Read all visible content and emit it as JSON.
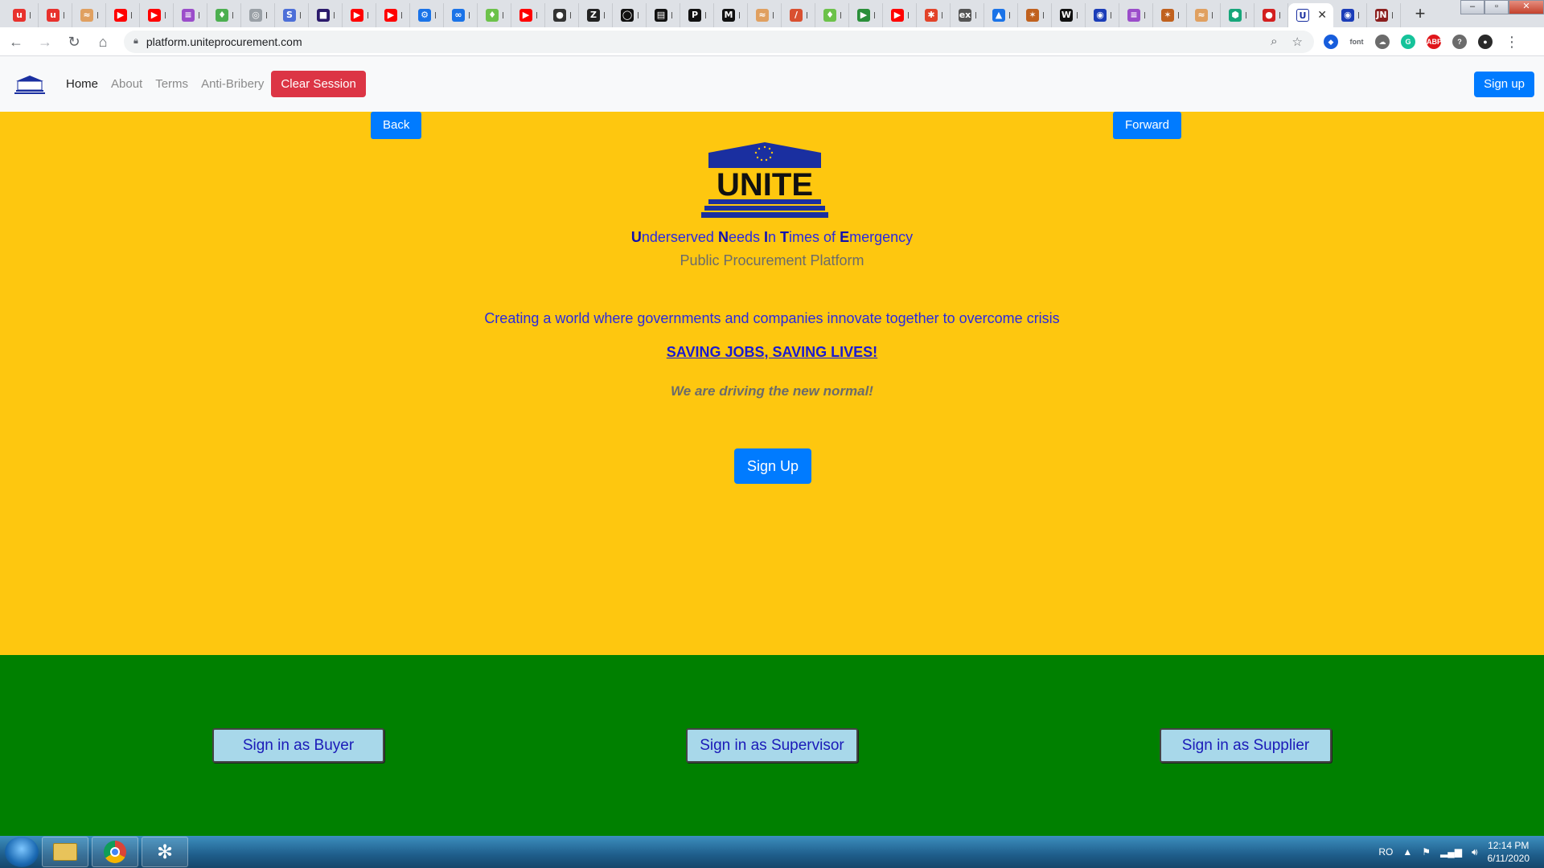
{
  "browser": {
    "tabs": [
      {
        "icon": "hermes-icon",
        "color": "#e8312d",
        "glyph": "u"
      },
      {
        "icon": "hermes-icon",
        "color": "#e8312d",
        "glyph": "u"
      },
      {
        "icon": "app-icon",
        "color": "#e0a060",
        "glyph": "≈"
      },
      {
        "icon": "youtube-icon",
        "color": "#ff0000",
        "glyph": "▶"
      },
      {
        "icon": "youtube-icon",
        "color": "#ff0000",
        "glyph": "▶"
      },
      {
        "icon": "app-icon",
        "color": "#9b4dca",
        "glyph": "≡"
      },
      {
        "icon": "leaf-icon",
        "color": "#4caf50",
        "glyph": "♦"
      },
      {
        "icon": "globe-icon",
        "color": "#9aa0a6",
        "glyph": "◎"
      },
      {
        "icon": "s-icon",
        "color": "#4d6fd8",
        "glyph": "S"
      },
      {
        "icon": "dark-icon",
        "color": "#2b1a6b",
        "glyph": "■"
      },
      {
        "icon": "youtube-icon",
        "color": "#ff0000",
        "glyph": "▶"
      },
      {
        "icon": "youtube-icon",
        "color": "#ff0000",
        "glyph": "▶"
      },
      {
        "icon": "gear-icon",
        "color": "#1a73e8",
        "glyph": "⚙"
      },
      {
        "icon": "link-icon",
        "color": "#1a73e8",
        "glyph": "∞"
      },
      {
        "icon": "leaf-icon",
        "color": "#6cc24a",
        "glyph": "♦"
      },
      {
        "icon": "youtube-icon",
        "color": "#ff0000",
        "glyph": "▶"
      },
      {
        "icon": "github-icon",
        "color": "#333333",
        "glyph": "●"
      },
      {
        "icon": "z-icon",
        "color": "#222222",
        "glyph": "Z"
      },
      {
        "icon": "circle-icon",
        "color": "#111111",
        "glyph": "◯"
      },
      {
        "icon": "terminal-icon",
        "color": "#111111",
        "glyph": "▤"
      },
      {
        "icon": "p-icon",
        "color": "#111111",
        "glyph": "P"
      },
      {
        "icon": "medium-icon",
        "color": "#111111",
        "glyph": "M"
      },
      {
        "icon": "app-icon",
        "color": "#e0a060",
        "glyph": "≈"
      },
      {
        "icon": "slash-icon",
        "color": "#d95030",
        "glyph": "/"
      },
      {
        "icon": "leaf-icon",
        "color": "#6cc24a",
        "glyph": "♦"
      },
      {
        "icon": "play-icon",
        "color": "#2a8f3a",
        "glyph": "▶"
      },
      {
        "icon": "youtube-icon",
        "color": "#ff0000",
        "glyph": "▶"
      },
      {
        "icon": "gitlab-icon",
        "color": "#e24329",
        "glyph": "✱"
      },
      {
        "icon": "ex-icon",
        "color": "#555555",
        "glyph": "ex"
      },
      {
        "icon": "cap-icon",
        "color": "#1a73e8",
        "glyph": "▲"
      },
      {
        "icon": "star-icon",
        "color": "#c0611e",
        "glyph": "✶"
      },
      {
        "icon": "wikipedia-icon",
        "color": "#111111",
        "glyph": "W"
      },
      {
        "icon": "eu-icon",
        "color": "#1b3db8",
        "glyph": "◉"
      },
      {
        "icon": "app-icon",
        "color": "#9b4dca",
        "glyph": "≡"
      },
      {
        "icon": "star-icon",
        "color": "#c0611e",
        "glyph": "✶"
      },
      {
        "icon": "app-icon",
        "color": "#e0a060",
        "glyph": "≈"
      },
      {
        "icon": "shield-icon",
        "color": "#17a67a",
        "glyph": "⬢"
      },
      {
        "icon": "record-icon",
        "color": "#d31f1f",
        "glyph": "●"
      }
    ],
    "active_tab": {
      "icon": "unite-tab-icon",
      "glyph": "U"
    },
    "trailing_tabs": [
      {
        "icon": "eu-icon",
        "color": "#1b3db8",
        "glyph": "◉"
      },
      {
        "icon": "jn-icon",
        "color": "#8b1f1f",
        "glyph": "JN"
      }
    ],
    "url": "platform.uniteprocurement.com",
    "extensions": [
      {
        "icon": "bitwarden-icon",
        "color": "#175ddc",
        "glyph": "◆"
      },
      {
        "icon": "font-icon",
        "color": "#5f6368",
        "glyph": "font"
      },
      {
        "icon": "cloud-icon",
        "color": "#6b6b6b",
        "glyph": "☁"
      },
      {
        "icon": "grammarly-icon",
        "color": "#15c39a",
        "glyph": "G"
      },
      {
        "icon": "adblock-icon",
        "color": "#e0161b",
        "glyph": "ABP"
      },
      {
        "icon": "extension-badge-icon",
        "color": "#6b6b6b",
        "glyph": "?"
      },
      {
        "icon": "profile-avatar-icon",
        "color": "#2a2a2a",
        "glyph": "●"
      }
    ]
  },
  "site": {
    "nav": {
      "home": "Home",
      "about": "About",
      "terms": "Terms",
      "anti_bribery": "Anti-Bribery",
      "clear_session": "Clear Session",
      "sign_up": "Sign up"
    },
    "hero": {
      "back": "Back",
      "forward": "Forward",
      "logo_text": "UNITE",
      "acronym": [
        {
          "initial": "U",
          "rest": "nderserved "
        },
        {
          "initial": "N",
          "rest": "eeds "
        },
        {
          "initial": "I",
          "rest": "n "
        },
        {
          "initial": "T",
          "rest": "imes of "
        },
        {
          "initial": "E",
          "rest": "mergency"
        }
      ],
      "subtitle": "Public Procurement Platform",
      "tagline": "Creating a world where governments and companies innovate together to overcome crisis",
      "slogan": "SAVING JOBS, SAVING LIVES!",
      "driving": "We are driving the new normal!",
      "sign_up": "Sign Up"
    },
    "signin": {
      "buyer": "Sign in as Buyer",
      "supervisor": "Sign in as Supervisor",
      "supplier": "Sign in as Supplier"
    },
    "colors": {
      "hero_bg": "#fec70f",
      "footer_bg": "#008000",
      "primary": "#007bff",
      "danger": "#dc3545"
    }
  },
  "taskbar": {
    "language": "RO",
    "time": "12:14 PM",
    "date": "6/11/2020",
    "apps": [
      "file-explorer-icon",
      "chrome-icon",
      "slack-icon"
    ]
  }
}
